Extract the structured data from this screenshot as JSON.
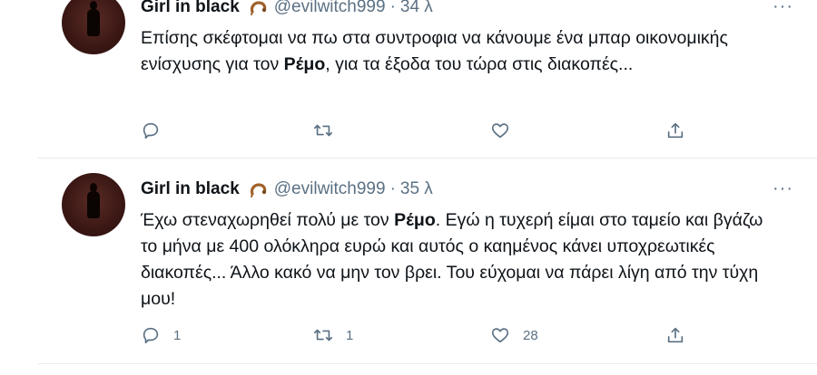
{
  "tweets": [
    {
      "author": {
        "display_name": "Girl in black",
        "handle": "@evilwitch999",
        "emoji": "snake-ring-emoji"
      },
      "separator": "·",
      "time": "34 λ",
      "text": {
        "before": "Επίσης σκέφτομαι να πω στα συντροφια να κάνουμε ένα μπαρ οικονομικής ενίσχυσης για τον ",
        "bold": "Ρέμο",
        "after": ", για τα έξοδα του τώρα στις διακοπές..."
      },
      "counts": {
        "replies": "",
        "retweets": "",
        "likes": ""
      }
    },
    {
      "author": {
        "display_name": "Girl in black",
        "handle": "@evilwitch999",
        "emoji": "snake-ring-emoji"
      },
      "separator": "·",
      "time": "35 λ",
      "text": {
        "before": "Έχω στεναχωρηθεί πολύ με τον ",
        "bold": "Ρέμο",
        "after": ". Εγώ η τυχερή είμαι στο ταμείο και βγάζω το μήνα με 400 ολόκληρα ευρώ και αυτός ο καημένος κάνει υποχρεωτικές διακοπές... Άλλο κακό να μην τον βρει. Του εύχομαι να πάρει λίγη από την τύχη μου!"
      },
      "counts": {
        "replies": "1",
        "retweets": "1",
        "likes": "28"
      }
    }
  ],
  "more_label": "···",
  "icons": {
    "reply": "reply-icon",
    "retweet": "retweet-icon",
    "like": "heart-icon",
    "share": "share-icon",
    "more": "more-icon"
  },
  "colors": {
    "text": "#0f1419",
    "secondary": "#5b7083",
    "divider": "#e6ecf0"
  }
}
